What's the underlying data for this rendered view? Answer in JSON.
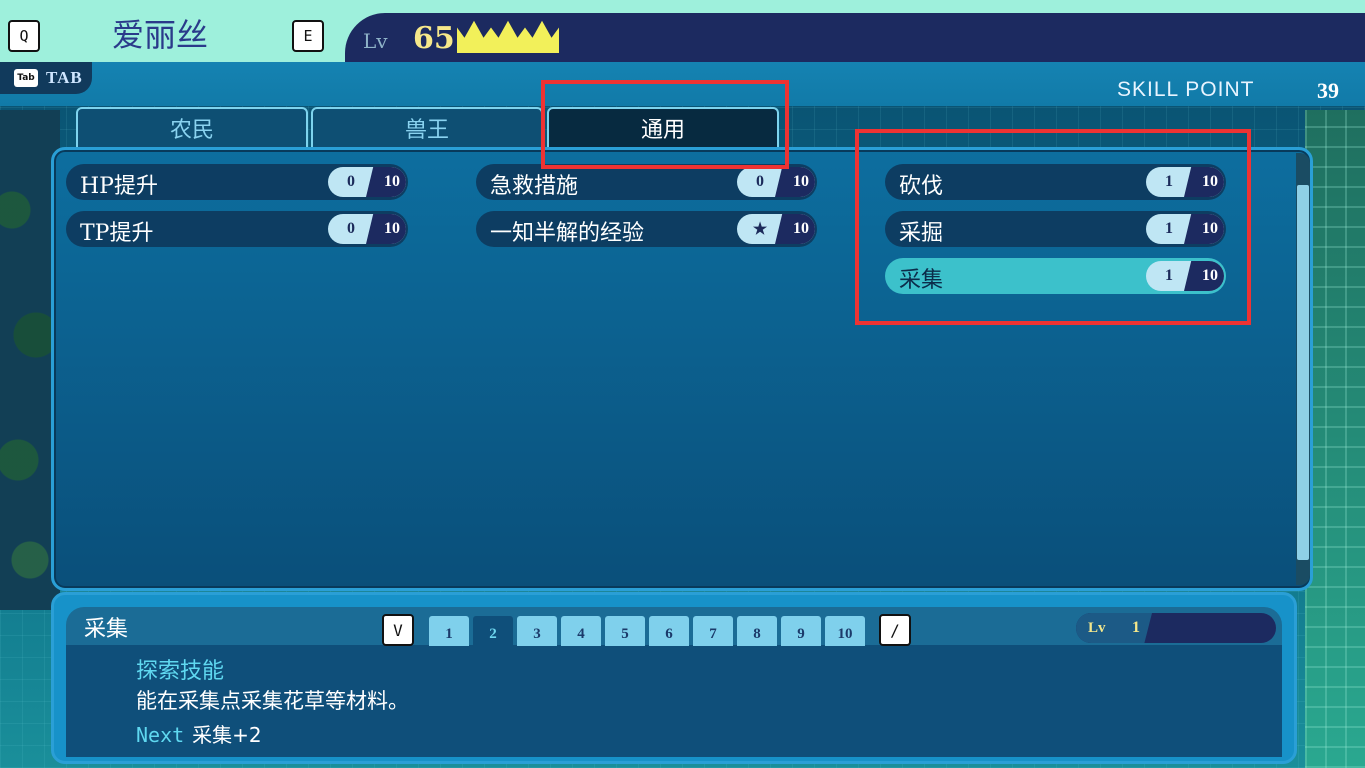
{
  "header": {
    "key_prev": "Q",
    "character_name": "爱丽丝",
    "key_next": "E",
    "level_label": "Lv",
    "level_value": "65",
    "tab_key_icon_text": "Tab",
    "tab_label": "TAB",
    "skill_point_label": "SKILL POINT",
    "skill_point_value": "39"
  },
  "class_tabs": [
    {
      "label": "农民",
      "active": false
    },
    {
      "label": "兽王",
      "active": false
    },
    {
      "label": "通用",
      "active": true
    }
  ],
  "skills": [
    {
      "name": "HP提升",
      "current": "0",
      "max": "10"
    },
    {
      "name": "TP提升",
      "current": "0",
      "max": "10"
    },
    {
      "name": "急救措施",
      "current": "0",
      "max": "10"
    },
    {
      "name": "一知半解的经验",
      "current": "★",
      "max": "10"
    },
    {
      "name": "砍伐",
      "current": "1",
      "max": "10"
    },
    {
      "name": "采掘",
      "current": "1",
      "max": "10"
    },
    {
      "name": "采集",
      "current": "1",
      "max": "10",
      "selected": true
    }
  ],
  "detail": {
    "title": "采集",
    "key_left": "V",
    "levels": [
      "1",
      "2",
      "3",
      "4",
      "5",
      "6",
      "7",
      "8",
      "9",
      "10"
    ],
    "active_level_tab": "2",
    "key_right": "/",
    "lv_label": "Lv",
    "lv_value": "1",
    "category": "探索技能",
    "description": "能在采集点采集花草等材料。",
    "next_label": "Next",
    "next_value": "采集+2"
  },
  "colors": {
    "highlight": "#ee3333",
    "crown": "#f2f05a",
    "selected_skill": "#3cc1cb",
    "accent_text": "#5fd8f0"
  },
  "icons": {
    "crown": "crown-icon",
    "star": "star-icon"
  }
}
